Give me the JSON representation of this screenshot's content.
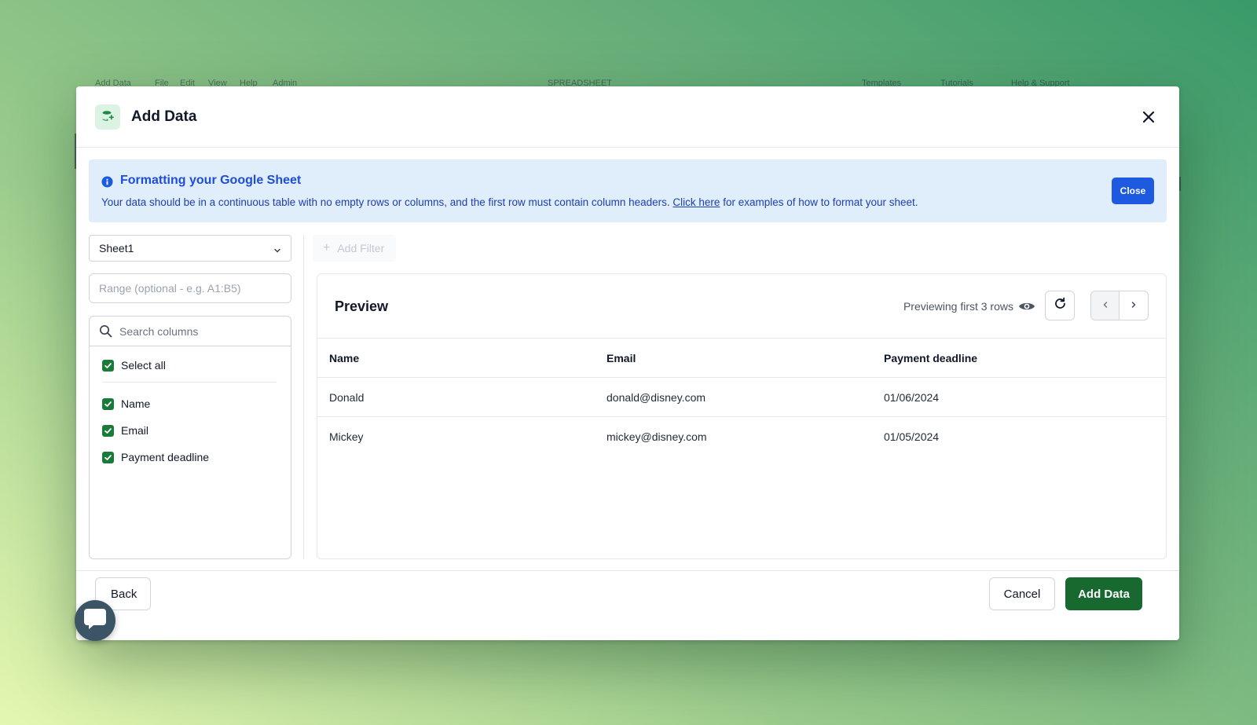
{
  "background": {
    "app_menu_items": [
      "Add Data",
      "File",
      "Edit",
      "View",
      "Help",
      "Admin",
      "SPREADSHEET",
      "Templates",
      "Tutorials",
      "Help & Support"
    ]
  },
  "modal": {
    "title": "Add Data",
    "header_icon": "database-plus-icon",
    "close_icon": "close-icon"
  },
  "banner": {
    "title": "Formatting your Google Sheet",
    "text_before_link": "Your data should be in a continuous table with no empty rows or columns, and the first row must contain column headers. ",
    "link_text": "Click here",
    "text_after_link": " for examples of how to format your sheet.",
    "close_label": "Close",
    "icon": "info-icon"
  },
  "sidebar": {
    "sheet_selected": "Sheet1",
    "range_placeholder": "Range (optional - e.g. A1:B5)",
    "search_placeholder": "Search columns",
    "select_all_label": "Select all",
    "columns": [
      {
        "label": "Name",
        "checked": true
      },
      {
        "label": "Email",
        "checked": true
      },
      {
        "label": "Payment deadline",
        "checked": true
      }
    ]
  },
  "filter": {
    "add_filter_label": "Add Filter"
  },
  "preview": {
    "title": "Preview",
    "meta": "Previewing first 3 rows",
    "headers": [
      "Name",
      "Email",
      "Payment deadline"
    ],
    "rows": [
      [
        "Donald",
        "donald@disney.com",
        "01/06/2024"
      ],
      [
        "Mickey",
        "mickey@disney.com",
        "01/05/2024"
      ]
    ]
  },
  "footer": {
    "back_label": "Back",
    "cancel_label": "Cancel",
    "add_label": "Add Data"
  },
  "colors": {
    "primary_green": "#17692f",
    "checkbox_green": "#1a7a3a",
    "info_blue": "#1d4ed8",
    "banner_bg": "#e0edfb",
    "close_button_blue": "#1d5ae0",
    "chat_bubble": "#3c5566"
  }
}
